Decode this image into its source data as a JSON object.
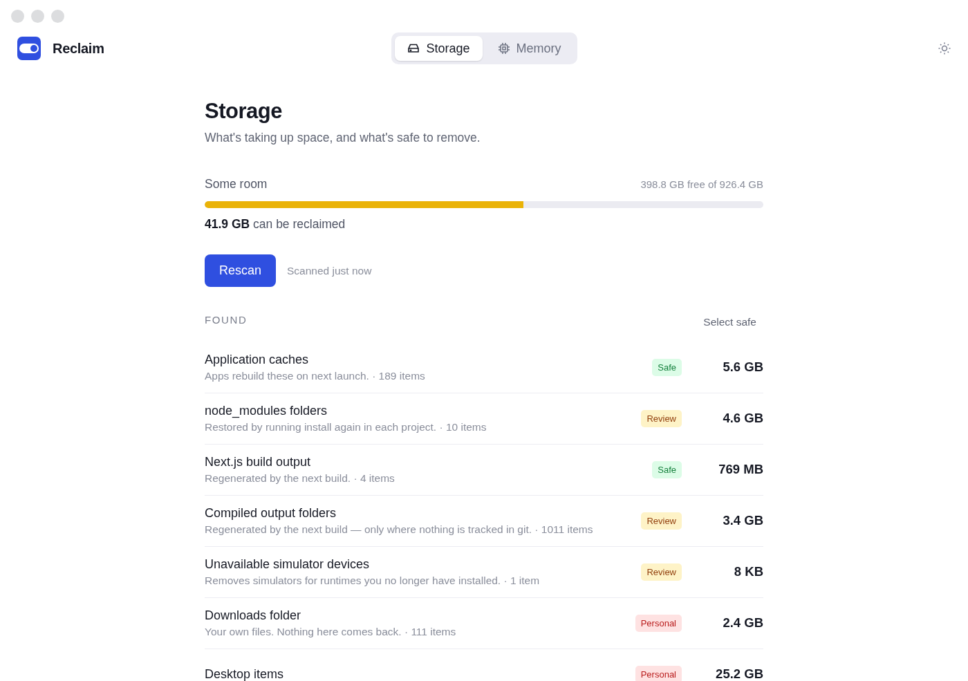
{
  "app": {
    "name": "Reclaim"
  },
  "tabs": [
    {
      "label": "Storage",
      "kind": "drive",
      "selected": true
    },
    {
      "label": "Memory",
      "kind": "chip",
      "selected": false
    }
  ],
  "page": {
    "title": "Storage",
    "subtitle": "What's taking up space, and what's safe to remove."
  },
  "usage": {
    "label": "Some room",
    "reading": "398.8 GB free of 926.4 GB",
    "level": 0.57,
    "reclaim_amount": "41.9 GB",
    "reclaim_text": "can be reclaimed"
  },
  "rescan": {
    "button": "Rescan",
    "status": "Scanned just now"
  },
  "found": {
    "heading": "FOUND",
    "select_safe": "Select safe"
  },
  "items": [
    {
      "name": "Application caches",
      "description": "Apps rebuild these on next launch. · 189 items",
      "tag": "Safe",
      "kind": "safe",
      "size": "5.6 GB"
    },
    {
      "name": "node_modules folders",
      "description": "Restored by running install again in each project. · 10 items",
      "tag": "Review",
      "kind": "review",
      "size": "4.6 GB"
    },
    {
      "name": "Next.js build output",
      "description": "Regenerated by the next build. · 4 items",
      "tag": "Safe",
      "kind": "safe",
      "size": "769 MB"
    },
    {
      "name": "Compiled output folders",
      "description": "Regenerated by the next build — only where nothing is tracked in git. · 1011 items",
      "tag": "Review",
      "kind": "review",
      "size": "3.4 GB"
    },
    {
      "name": "Unavailable simulator devices",
      "description": "Removes simulators for runtimes you no longer have installed. · 1 item",
      "tag": "Review",
      "kind": "review",
      "size": "8 KB"
    },
    {
      "name": "Downloads folder",
      "description": "Your own files. Nothing here comes back. · 111 items",
      "tag": "Personal",
      "kind": "personal",
      "size": "2.4 GB"
    },
    {
      "name": "Desktop items",
      "tag": "Personal",
      "kind": "personal",
      "size": "25.2 GB"
    }
  ]
}
